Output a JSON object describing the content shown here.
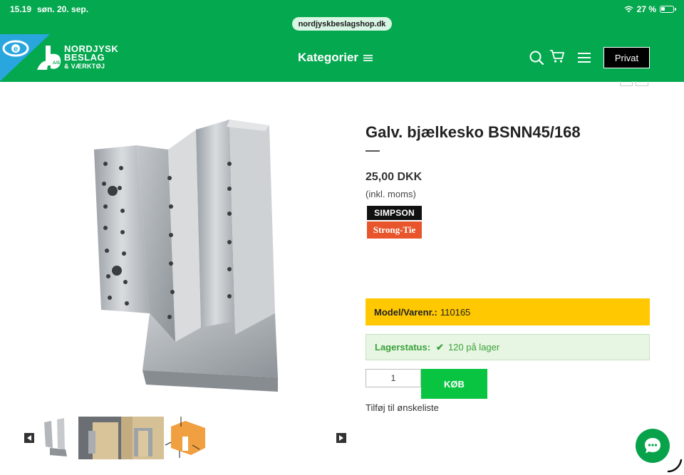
{
  "status_bar": {
    "time": "15.19",
    "date": "søn. 20. sep.",
    "battery": "27 %"
  },
  "browser": {
    "url": "nordjyskbeslagshop.dk"
  },
  "header": {
    "logo_line1": "NORDJYSK",
    "logo_line2": "BESLAG",
    "logo_line3": "& VÆRKTØJ",
    "logo_badge": "A/S",
    "categories_label": "Kategorier",
    "account_button": "Privat",
    "colors": {
      "brand_green": "#04a84f",
      "corner_tab": "#2aa6df"
    }
  },
  "product": {
    "title": "Galv. bjælkesko BSNN45/168",
    "price": "25,00 DKK",
    "vat_note": "(inkl. moms)",
    "brand_top": "SIMPSON",
    "brand_bottom": "Strong-Tie",
    "model_label": "Model/Varenr.:",
    "model_value": "110165",
    "stock_label": "Lagerstatus:",
    "stock_value": "120 på lager",
    "quantity": "1",
    "buy_button": "KØB",
    "wishlist": "Tilføj til ønskeliste",
    "colors": {
      "model_bg": "#ffc800",
      "stock_bg": "#e7f5e3",
      "buy": "#08c440"
    }
  },
  "icons": {
    "search": "search-icon",
    "cart": "cart-icon",
    "menu": "menu-icon",
    "chat": "chat-icon"
  }
}
